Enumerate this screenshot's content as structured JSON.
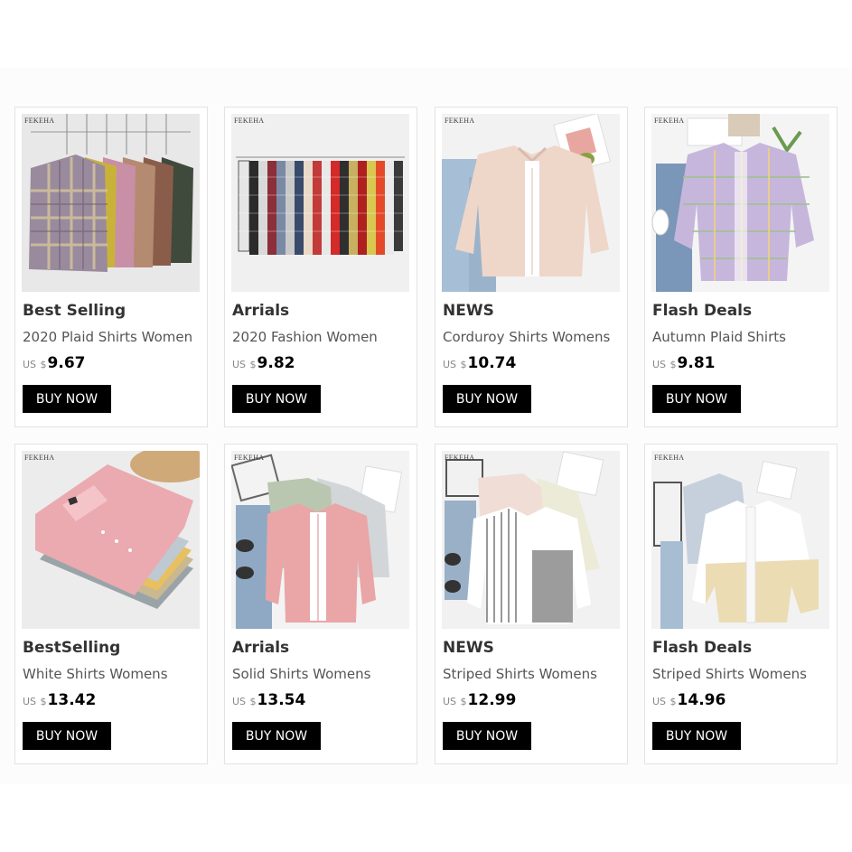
{
  "colors": {
    "button_bg": "#000000",
    "button_text": "#ffffff",
    "price": "#000000",
    "title": "#333333"
  },
  "products": [
    {
      "brand": "FEKEHA",
      "title": "Best Selling",
      "subtitle": "2020 Plaid Shirts Women",
      "currency": "US",
      "symbol": "$",
      "price": "9.67",
      "button": "BUY NOW",
      "image": "hanging-plaid-shirts"
    },
    {
      "brand": "FEKEHA",
      "title": "Arrials",
      "subtitle": "2020 Fashion Women",
      "currency": "US",
      "symbol": "$",
      "price": "9.82",
      "button": "BUY NOW",
      "image": "rack-of-checked-shirts"
    },
    {
      "brand": "FEKEHA",
      "title": "NEWS",
      "subtitle": "Corduroy Shirts Womens",
      "currency": "US",
      "symbol": "$",
      "price": "10.74",
      "button": "BUY NOW",
      "image": "pink-corduroy-shirt-flatlay"
    },
    {
      "brand": "FEKEHA",
      "title": "Flash Deals",
      "subtitle": "Autumn Plaid Shirts",
      "currency": "US",
      "symbol": "$",
      "price": "9.81",
      "button": "BUY NOW",
      "image": "lilac-plaid-shirt-flatlay"
    },
    {
      "brand": "FEKEHA",
      "title": "BestSelling",
      "subtitle": "White Shirts Womens",
      "currency": "US",
      "symbol": "$",
      "price": "13.42",
      "button": "BUY NOW",
      "image": "folded-shirt-stack"
    },
    {
      "brand": "FEKEHA",
      "title": "Arrials",
      "subtitle": "Solid Shirts Womens",
      "currency": "US",
      "symbol": "$",
      "price": "13.54",
      "button": "BUY NOW",
      "image": "pink-solid-shirts-flatlay"
    },
    {
      "brand": "FEKEHA",
      "title": "NEWS",
      "subtitle": "Striped Shirts Womens",
      "currency": "US",
      "symbol": "$",
      "price": "12.99",
      "button": "BUY NOW",
      "image": "striped-shirts-flatlay"
    },
    {
      "brand": "FEKEHA",
      "title": "Flash Deals",
      "subtitle": "Striped Shirts Womens",
      "currency": "US",
      "symbol": "$",
      "price": "14.96",
      "button": "BUY NOW",
      "image": "colorblock-shirts-flatlay"
    }
  ]
}
